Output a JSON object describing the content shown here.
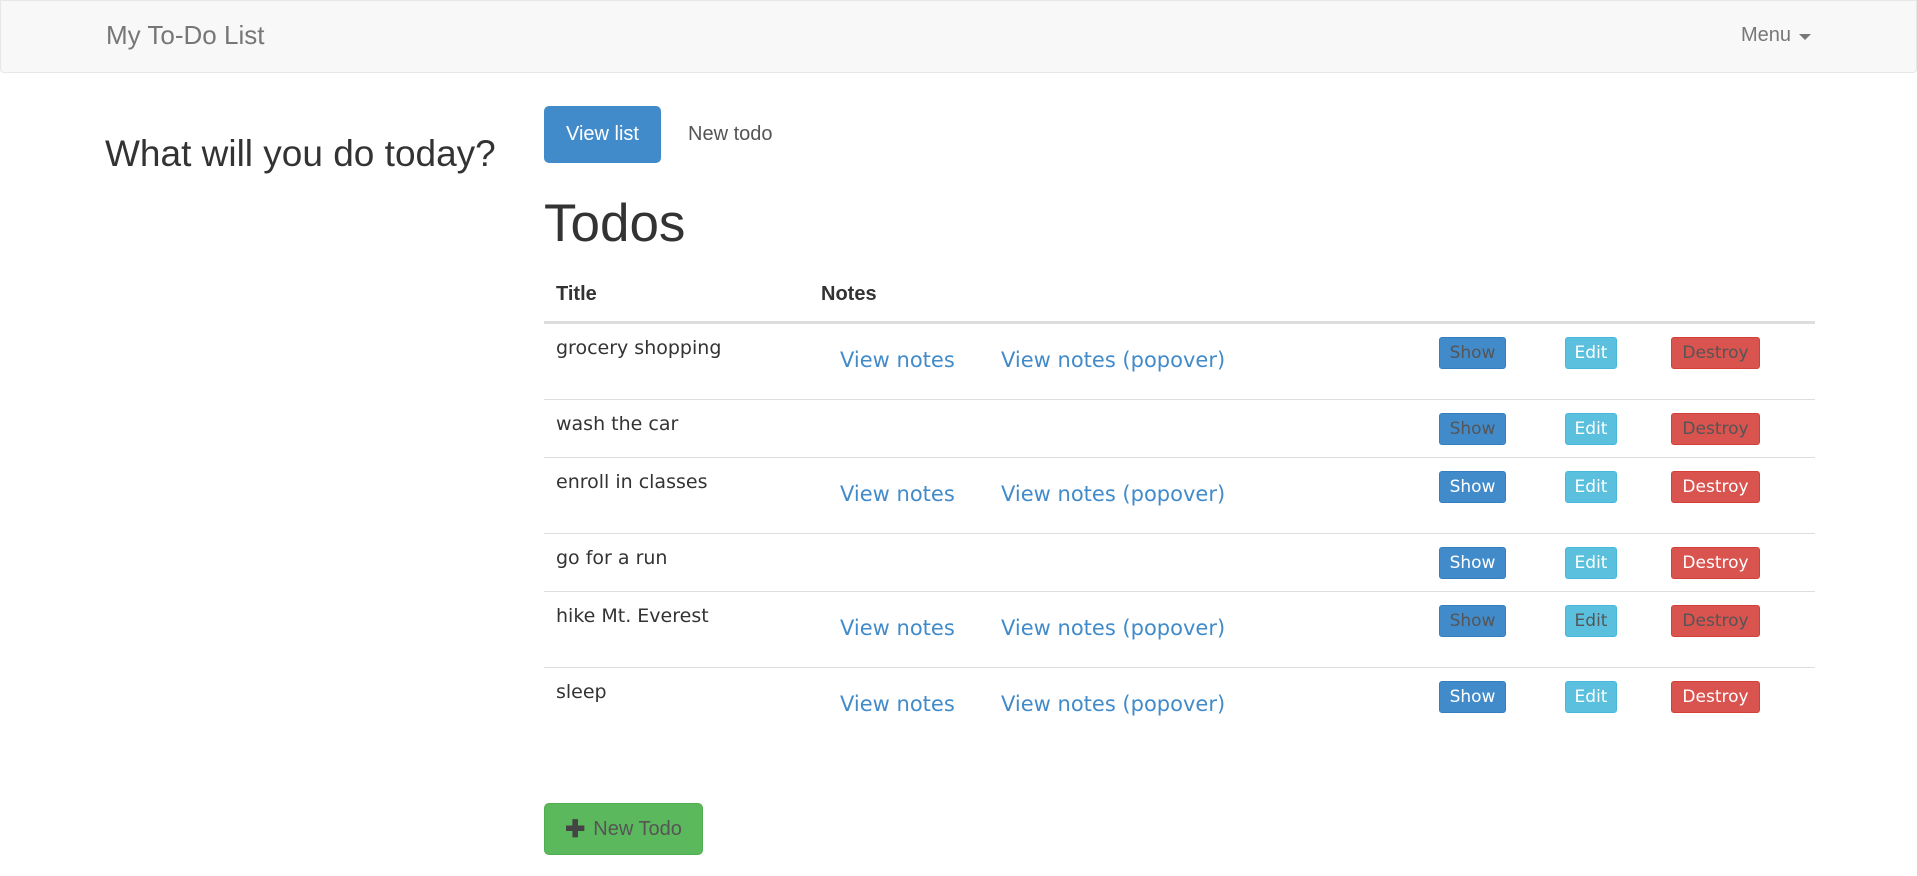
{
  "navbar": {
    "brand": "My To-Do List",
    "menu_label": "Menu"
  },
  "sidebar": {
    "heading": "What will you do today?"
  },
  "tabs": [
    {
      "label": "View list",
      "active": true
    },
    {
      "label": "New todo",
      "active": false
    }
  ],
  "page_title": "Todos",
  "table": {
    "columns": [
      "Title",
      "Notes"
    ],
    "actions": {
      "show": "Show",
      "edit": "Edit",
      "destroy": "Destroy"
    },
    "note_links": {
      "view": "View notes",
      "popover": "View notes (popover)"
    },
    "rows": [
      {
        "title": "grocery shopping",
        "has_notes": true,
        "show_text_muted": true,
        "edit_text_muted": false,
        "destroy_text_muted": true
      },
      {
        "title": "wash the car",
        "has_notes": false,
        "show_text_muted": true,
        "edit_text_muted": false,
        "destroy_text_muted": true
      },
      {
        "title": "enroll in classes",
        "has_notes": true,
        "show_text_muted": false,
        "edit_text_muted": false,
        "destroy_text_muted": false
      },
      {
        "title": "go for a run",
        "has_notes": false,
        "show_text_muted": false,
        "edit_text_muted": false,
        "destroy_text_muted": false
      },
      {
        "title": "hike Mt. Everest",
        "has_notes": true,
        "show_text_muted": true,
        "edit_text_muted": true,
        "destroy_text_muted": true
      },
      {
        "title": "sleep",
        "has_notes": true,
        "show_text_muted": false,
        "edit_text_muted": false,
        "destroy_text_muted": false
      }
    ]
  },
  "new_todo_button": {
    "label": "New Todo",
    "icon": "plus-icon"
  },
  "colors": {
    "primary": "#428bca",
    "info": "#5bc0de",
    "danger": "#d9534f",
    "success": "#5cb85c"
  }
}
